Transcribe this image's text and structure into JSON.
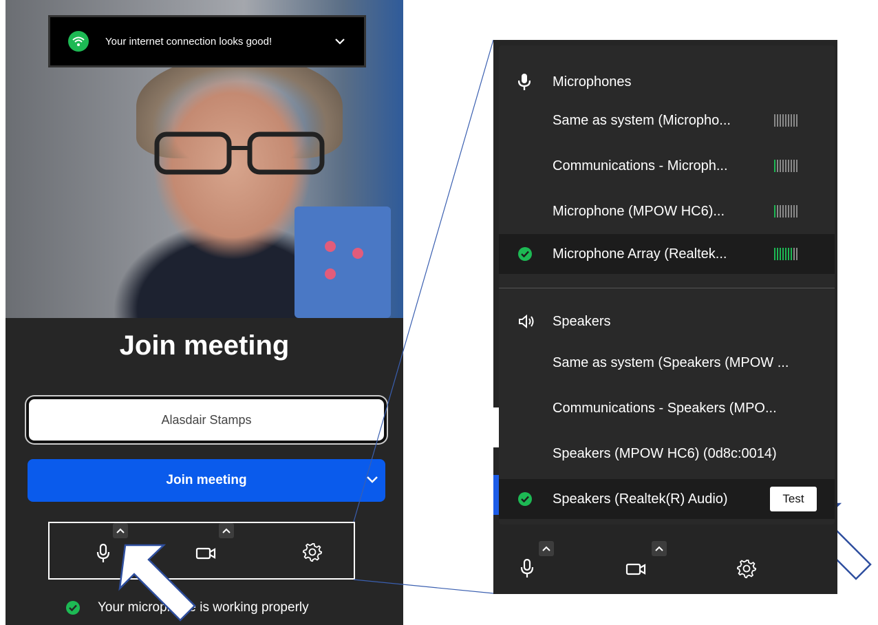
{
  "banner": {
    "text": "Your internet connection looks good!",
    "icon": "wifi-icon"
  },
  "join": {
    "title": "Join meeting",
    "name_value": "Alasdair Stamps",
    "button_label": "Join meeting"
  },
  "status": {
    "text": "Your microphone is working properly"
  },
  "device_menu": {
    "microphones": {
      "heading": "Microphones",
      "items": [
        {
          "label": "Same as system (Micropho...",
          "level": 0,
          "selected": false
        },
        {
          "label": "Communications - Microph...",
          "level": 1,
          "selected": false
        },
        {
          "label": "Microphone (MPOW HC6)...",
          "level": 1,
          "selected": false
        },
        {
          "label": "Microphone Array (Realtek...",
          "level": 7,
          "selected": true
        }
      ]
    },
    "speakers": {
      "heading": "Speakers",
      "items": [
        {
          "label": "Same as system (Speakers (MPOW ...",
          "selected": false
        },
        {
          "label": "Communications - Speakers (MPO...",
          "selected": false
        },
        {
          "label": "Speakers (MPOW HC6) (0d8c:0014)",
          "selected": false
        },
        {
          "label": "Speakers (Realtek(R) Audio)",
          "selected": true
        }
      ],
      "test_label": "Test"
    }
  },
  "colors": {
    "accent": "#0a5bec",
    "success": "#1db954",
    "panel": "#262626"
  }
}
